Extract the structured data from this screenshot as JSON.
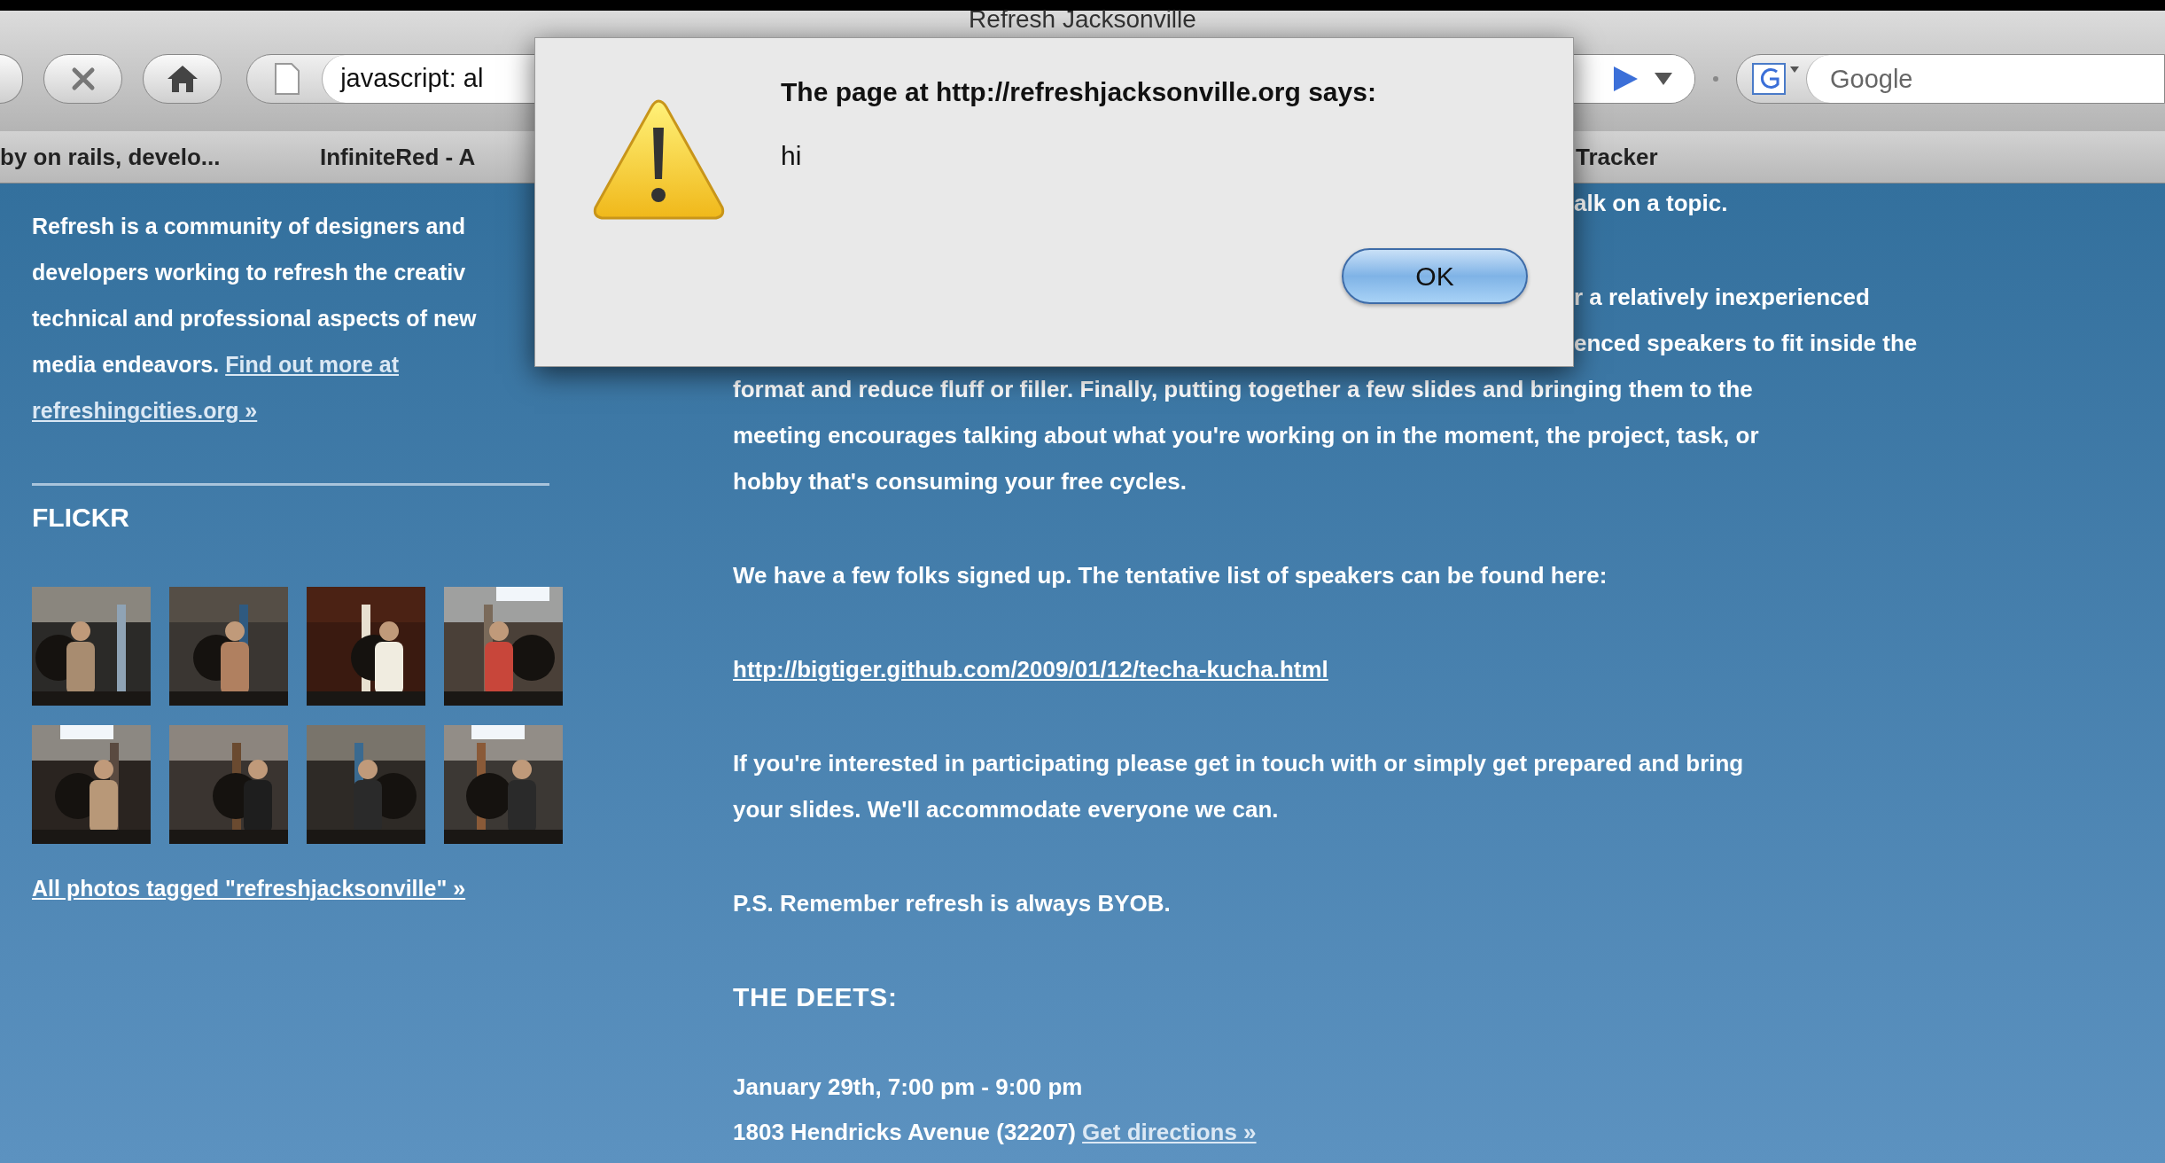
{
  "window": {
    "title": "Refresh Jacksonville"
  },
  "toolbar": {
    "address": "javascript: al",
    "search_placeholder": "Google"
  },
  "bookmarks": [
    "by on rails, develo...",
    "InfiniteRed - A",
    "Tracker"
  ],
  "sidebar": {
    "intro_lines": [
      "Refresh is a community of designers and",
      "developers working to refresh the creativ",
      "technical and professional aspects of new",
      "media endeavors."
    ],
    "intro_links": [
      "Find out more at",
      "refreshingcities.org »"
    ],
    "flickr": {
      "heading": "FLICKR",
      "link": "All photos tagged \"refreshjacksonville\" »"
    }
  },
  "main": {
    "fragments": [
      "alk on a topic.",
      "r a relatively inexperienced",
      "enced speakers to fit inside the"
    ],
    "blocks": [
      {
        "kind": "text",
        "lines": [
          "format and reduce fluff or filler. Finally, putting together a few slides and bringing them to the",
          "meeting encourages talking about what you're working on in the moment, the project, task, or",
          "hobby that's consuming your free cycles."
        ]
      },
      {
        "kind": "text",
        "lines": [
          "We have a few folks signed up. The tentative list of speakers can be found here:"
        ]
      },
      {
        "kind": "link",
        "lines": [
          "http://bigtiger.github.com/2009/01/12/techa-kucha.html"
        ]
      },
      {
        "kind": "text",
        "lines": [
          "If you're interested in participating please get in touch with or simply get prepared and bring",
          "your slides. We'll accommodate everyone we can."
        ]
      },
      {
        "kind": "text",
        "lines": [
          "P.S. Remember refresh is always BYOB."
        ]
      },
      {
        "kind": "heading",
        "lines": [
          "THE DEETS:"
        ]
      },
      {
        "kind": "details",
        "lines": [
          "January 29th, 7:00 pm - 9:00 pm",
          "1803 Hendricks Avenue (32207)"
        ],
        "link": "Get directions »"
      }
    ]
  },
  "dialog": {
    "title": "The page at http://refreshjacksonville.org says:",
    "message": "hi",
    "button": "OK"
  }
}
